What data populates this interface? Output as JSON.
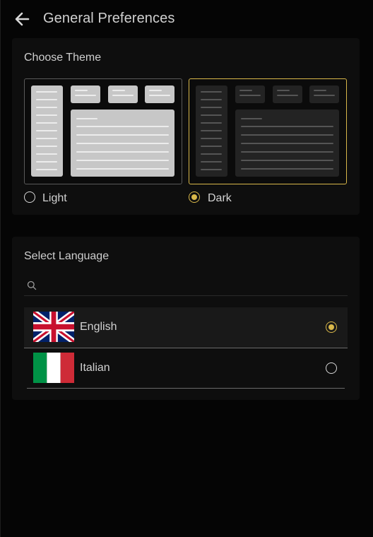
{
  "header": {
    "title": "General Preferences"
  },
  "theme": {
    "label": "Choose Theme",
    "options": [
      {
        "label": "Light",
        "selected": false
      },
      {
        "label": "Dark",
        "selected": true
      }
    ]
  },
  "language": {
    "label": "Select Language",
    "search": {
      "placeholder": "",
      "value": ""
    },
    "options": [
      {
        "name": "English",
        "flag": "uk-flag",
        "selected": true
      },
      {
        "name": "Italian",
        "flag": "italy-flag",
        "selected": false
      }
    ]
  },
  "colors": {
    "accent": "#d9b84a",
    "background": "#050505",
    "card": "#0e0e0e"
  }
}
